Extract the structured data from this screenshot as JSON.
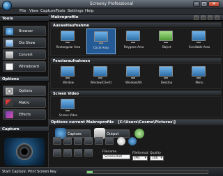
{
  "window": {
    "title": "Screeny Professional"
  },
  "menu": [
    "File",
    "View",
    "Capture",
    "Tools",
    "Settings",
    "Help"
  ],
  "sidebar": {
    "tools_header": "Tools",
    "tools": [
      {
        "label": "Browser",
        "icon": "globe-icon"
      },
      {
        "label": "Dia Show",
        "icon": "slideshow-icon"
      },
      {
        "label": "Convert",
        "icon": "convert-icon"
      },
      {
        "label": "Whiteboard",
        "icon": "whiteboard-icon"
      }
    ],
    "options_header": "Options",
    "options": [
      {
        "label": "Options",
        "icon": "options-icon"
      },
      {
        "label": "Makro",
        "icon": "macro-icon"
      },
      {
        "label": "Effects",
        "icon": "effects-icon"
      }
    ],
    "capture_header": "Capture"
  },
  "main": {
    "title": "Makroprofile",
    "groups": [
      {
        "header": "Auswahlaufnahme",
        "items": [
          "Rectangular Area",
          "Circle Area",
          "Polygone Area",
          "Object",
          "Scrollable Area"
        ],
        "selected": 1
      },
      {
        "header": "Fensteraufnahmen",
        "items": [
          "Window",
          "Window(Client)",
          "Window(All)",
          "Desktop",
          "Menu"
        ]
      },
      {
        "header": "Screen Video",
        "items": [
          "Screen Video"
        ]
      }
    ]
  },
  "options_panel": {
    "header": "Options current Makroprofile",
    "path": "[C:\\Users\\Cosmo\\Pictures\\]",
    "capture_label": "Capture",
    "output_label": "Output",
    "filename_label": "Filename",
    "filename_value": "Screenshot",
    "fileformat_label": "Fileformat",
    "fileformat_value": "JPG",
    "quality_label": "Quality",
    "quality_value": "100"
  },
  "status": {
    "text": "Start Capture: Print Screen Key"
  },
  "colors": {
    "accent": "#245a96",
    "title_bar": "#4a525c",
    "scroll_thumb": "#7ed07e"
  }
}
